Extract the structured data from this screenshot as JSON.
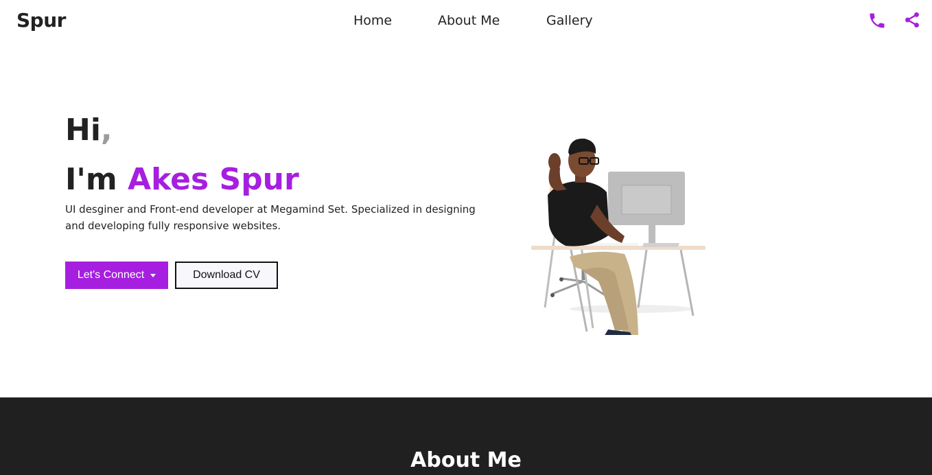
{
  "nav": {
    "brand": "Spur",
    "links": [
      "Home",
      "About Me",
      "Gallery"
    ]
  },
  "hero": {
    "greeting": "Hi",
    "greeting_mark": ",",
    "intro_prefix": "I'm ",
    "name": "Akes Spur",
    "description": "UI desginer and Front-end developer at Megamind Set. Specialized in designing and developing fully responsive websites.",
    "connect_label": "Let's Connect",
    "cv_label": "Download CV"
  },
  "about": {
    "title": "About Me"
  },
  "icons": {
    "phone": "phone-icon",
    "share": "share-icon",
    "caret": "caret-down-icon"
  },
  "colors": {
    "accent": "#a61fe0",
    "text": "#222222",
    "dark_section": "#202020"
  }
}
